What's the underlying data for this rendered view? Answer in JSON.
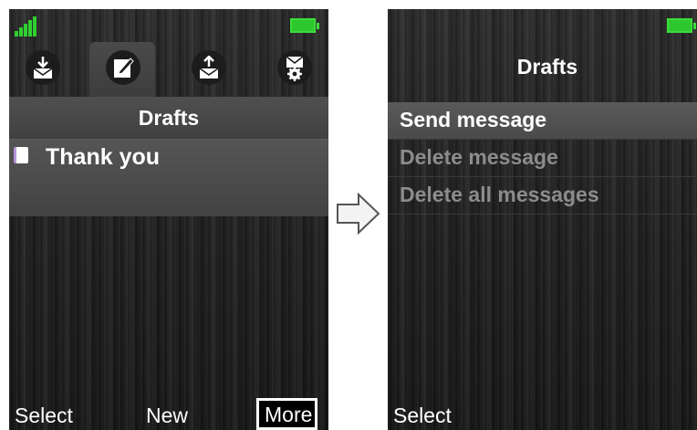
{
  "left_screen": {
    "status_bar": {
      "signal_icon": "signal-strength-icon",
      "battery_icon": "battery-icon"
    },
    "tabs": [
      {
        "name": "inbox",
        "icon": "inbox-download-icon",
        "active": false
      },
      {
        "name": "drafts",
        "icon": "drafts-pencil-icon",
        "active": true
      },
      {
        "name": "outbox",
        "icon": "outbox-upload-icon",
        "active": false
      },
      {
        "name": "settings",
        "icon": "message-settings-icon",
        "active": false
      }
    ],
    "title": "Drafts",
    "messages": [
      {
        "text": "Thank you",
        "icon": "draft-message-icon"
      }
    ],
    "softkeys": {
      "left": "Select",
      "center": "New",
      "right": "More"
    }
  },
  "transition_arrow_icon": "right-arrow-icon",
  "right_screen": {
    "status_bar": {
      "battery_icon": "battery-icon"
    },
    "title": "Drafts",
    "menu": [
      {
        "label": "Send message",
        "state": "selected"
      },
      {
        "label": "Delete message",
        "state": "disabled"
      },
      {
        "label": "Delete all messages",
        "state": "disabled"
      }
    ],
    "softkeys": {
      "left": "Select"
    }
  },
  "colors": {
    "signal_green": "#2fd12f",
    "battery_green": "#2ec72e",
    "draft_icon_accent": "#b894d8",
    "disabled_text": "#8c8c8c"
  }
}
